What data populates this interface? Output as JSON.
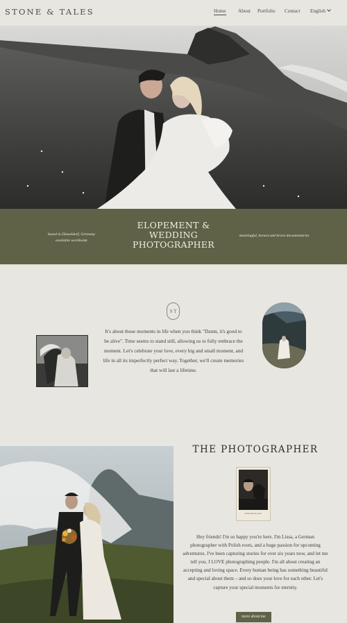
{
  "header": {
    "logo": "STONE & TALES",
    "nav": {
      "home": "Home",
      "about": "About",
      "portfolio": "Portfolio",
      "contact": "Contact",
      "language": "English"
    }
  },
  "band": {
    "left_line1": "based in Düsseldorf, Germany",
    "left_line2": "available worldwide",
    "title_line1": "ELOPEMENT &",
    "title_line2": "WEDDING",
    "title_line3": "PHOTOGRAPHER",
    "right": "meaningful, honest and brave documentaries"
  },
  "intro": {
    "monogram": "S T",
    "text": "It's about those moments in life when you think \"Damn, it's good to be alive\". Time seems to stand still, allowing us to fully embrace the moment. Let's celebrate your love, every big and small moment, and life in all its imperfectly perfect way. Together, we'll create memories that will last a lifetime."
  },
  "photographer": {
    "title": "THE PHOTOGRAPHER",
    "polaroid_caption": "Lissa and my love",
    "text": "Hey friends! I'm so happy you're here. I'm Lissa, a German photographer with Polish roots, and a huge passion for upcoming adventures. I've been capturing stories for over six years now, and let me tell you, I LOVE photographing people. I'm all about creating an accepting and loving space. Every human being has something beautiful and special about them – and so does your love for each other. Let's capture your special moments for eternity.",
    "button": "more about me"
  },
  "colors": {
    "background": "#e8e6e1",
    "accent_green": "#5f6246",
    "text_dark": "#2d2d2a"
  }
}
